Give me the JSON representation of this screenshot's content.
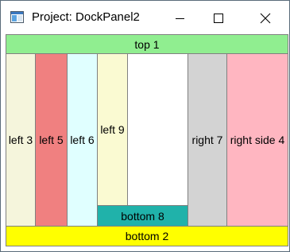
{
  "window": {
    "title": "Project: DockPanel2"
  },
  "panels": {
    "top1": {
      "label": "top 1",
      "color": "#90ee90"
    },
    "left3": {
      "label": "left 3",
      "color": "#f5f5dc"
    },
    "left5": {
      "label": "left 5",
      "color": "#f08080"
    },
    "left6": {
      "label": "left 6",
      "color": "#e0ffff"
    },
    "left9": {
      "label": "left 9",
      "color": "#fafad2"
    },
    "fill": {
      "label": "",
      "color": "#ffffff"
    },
    "bottom8": {
      "label": "bottom 8",
      "color": "#20b2aa"
    },
    "right7": {
      "label": "right 7",
      "color": "#d3d3d3"
    },
    "rightside4": {
      "label": "right side 4",
      "color": "#ffb6c1"
    },
    "bottom2": {
      "label": "bottom 2",
      "color": "#ffff00"
    }
  },
  "icons": {
    "app": "window-app-icon",
    "minimize": "minimize-icon",
    "maximize": "maximize-icon",
    "close": "close-icon"
  }
}
